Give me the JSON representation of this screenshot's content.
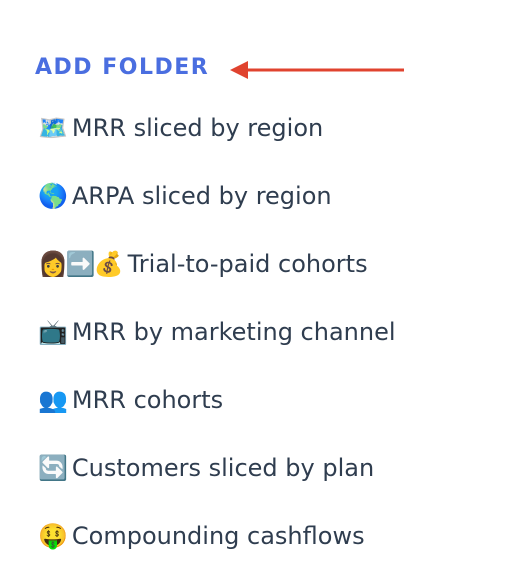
{
  "header": {
    "add_folder_label": "ADD FOLDER"
  },
  "colors": {
    "accent": "#4a6ee0",
    "arrow": "#e0432f",
    "text": "#2f3d4f"
  },
  "items": [
    {
      "icon": "map-icon",
      "emoji": "🗺️",
      "label": "MRR sliced by region"
    },
    {
      "icon": "globe-icon",
      "emoji": "🌎",
      "label": "ARPA sliced by region"
    },
    {
      "icon": "person-arrow-moneybag-icon",
      "emoji": "👩➡️💰",
      "label": "Trial-to-paid cohorts"
    },
    {
      "icon": "television-icon",
      "emoji": "📺",
      "label": "MRR by marketing channel"
    },
    {
      "icon": "people-icon",
      "emoji": "👥",
      "label": "MRR cohorts"
    },
    {
      "icon": "refresh-icon",
      "emoji": "🔄",
      "label": "Customers sliced by plan"
    },
    {
      "icon": "money-mouth-icon",
      "emoji": "🤑",
      "label": "Compounding cashflows"
    }
  ]
}
